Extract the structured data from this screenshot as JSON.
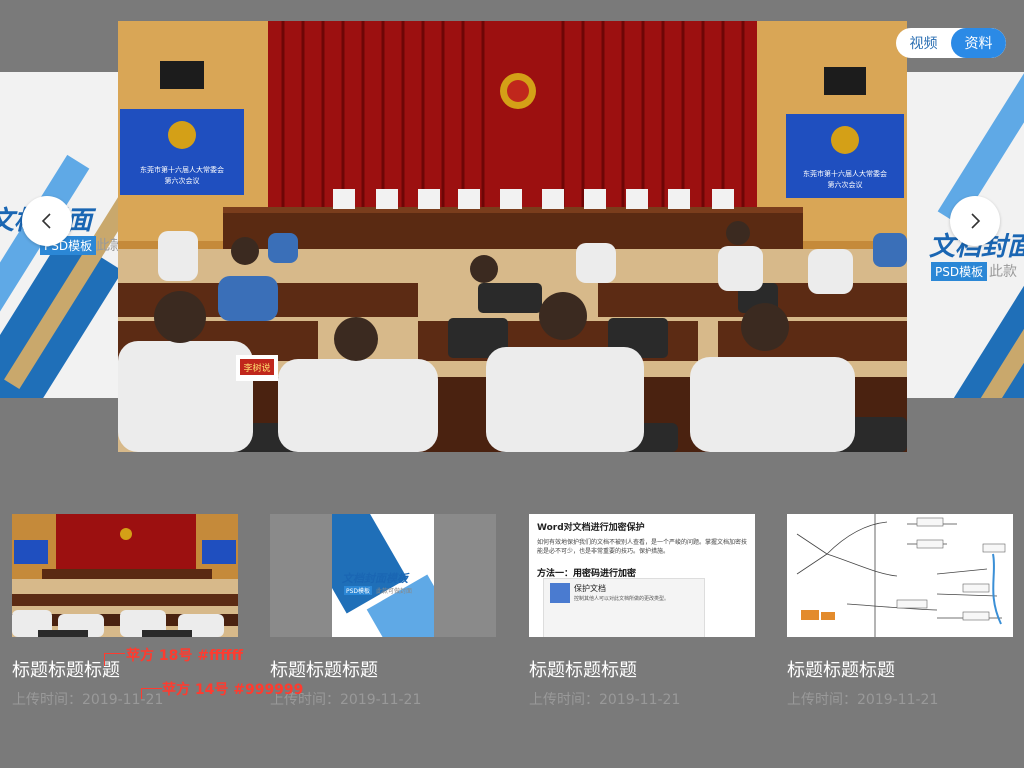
{
  "toggle": {
    "video_label": "视频",
    "doc_label": "资料"
  },
  "side_left": {
    "title": "文档封面",
    "tag": "PSD模板",
    "sub": "此款"
  },
  "side_right": {
    "title": "文档封面",
    "tag": "PSD模板",
    "sub": "此款"
  },
  "main_image": {
    "screen_caption_line1": "东莞市第十六届人大常委会",
    "screen_caption_line2": "第六次会议",
    "nameplate": "李树说"
  },
  "cards": [
    {
      "title": "标题标题标题",
      "meta": "上传时间：2019-11-21"
    },
    {
      "title": "标题标题标题",
      "meta": "上传时间：2019-11-21",
      "cover_title": "文档封面模板",
      "cover_tag": "PSD模板",
      "cover_sub": "此款可做封面"
    },
    {
      "title": "标题标题标题",
      "meta": "上传时间：2019-11-21",
      "doc_heading": "Word对文档进行加密保护",
      "doc_body": "如何有效地保护我们的文档不被别人查看，是一个严峻的问题。掌握文档加密技能是必不可少，也是非常重要的技巧。保护措施。",
      "doc_subheading": "方法一：用密码进行加密",
      "doc_panel_title": "保护文档",
      "doc_panel_text": "控制其他人可以对此文档所做的更改类型。"
    },
    {
      "title": "标题标题标题",
      "meta": "上传时间：2019-11-21"
    }
  ],
  "annotations": {
    "title_spec": "苹方   18号   #ffffff",
    "meta_spec": "苹方   14号   #999999"
  },
  "colors": {
    "page_bg": "#7a7a7a",
    "accent_blue": "#2b8ae6",
    "title_text": "#ffffff",
    "meta_text": "#999999",
    "annotation": "#ff3b2f"
  }
}
